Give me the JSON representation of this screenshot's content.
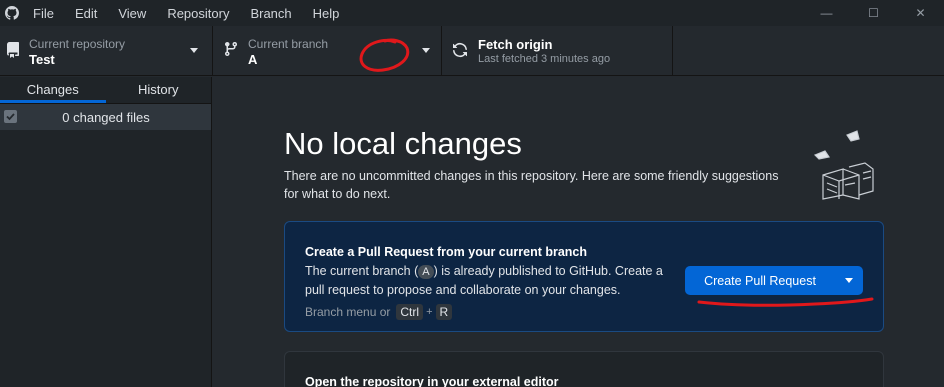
{
  "menu": {
    "items": [
      "File",
      "Edit",
      "View",
      "Repository",
      "Branch",
      "Help"
    ]
  },
  "window": {
    "minimize": "—",
    "maximize": "☐",
    "close": "✕"
  },
  "toolbar": {
    "repo_label": "Current repository",
    "repo_value": "Test",
    "branch_label": "Current branch",
    "branch_value": "A",
    "fetch_title": "Fetch origin",
    "fetch_sub": "Last fetched 3 minutes ago"
  },
  "sidebar": {
    "tabs": [
      "Changes",
      "History"
    ],
    "active_tab": "Changes",
    "changed_files": "0 changed files"
  },
  "main": {
    "heading": "No local changes",
    "intro": "There are no uncommitted changes in this repository. Here are some friendly suggestions for what to do next.",
    "pr_card": {
      "title": "Create a Pull Request from your current branch",
      "desc_before": "The current branch (",
      "branch": "A",
      "desc_after": ") is already published to GitHub. Create a pull request to propose and collaborate on your changes.",
      "hint_prefix": "Branch menu or",
      "key1": "Ctrl",
      "plus": "+",
      "key2": "R",
      "button": "Create Pull Request"
    },
    "editor_card": {
      "title": "Open the repository in your external editor"
    }
  },
  "colors": {
    "accent": "#0366d6",
    "annotation": "#e0181b"
  }
}
